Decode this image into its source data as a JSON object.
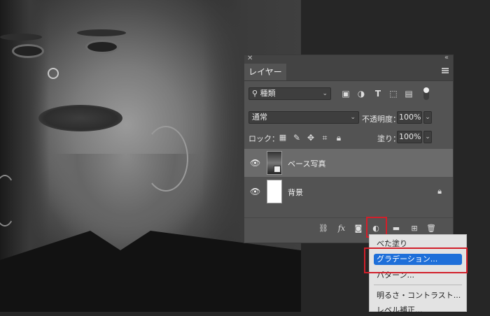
{
  "panel": {
    "tab_label": "レイヤー",
    "filter_kind": "種類",
    "blend_mode": "通常",
    "opacity_label": "不透明度：",
    "opacity_value": "100%",
    "lock_label": "ロック：",
    "fill_label": "塗り：",
    "fill_value": "100%",
    "layers": [
      {
        "name": "ベース写真",
        "selected": true,
        "visible": true,
        "locked": false
      },
      {
        "name": "背景",
        "selected": false,
        "visible": true,
        "locked": true
      }
    ],
    "footer_icons": [
      "link-icon",
      "fx-icon",
      "mask-icon",
      "adjustment-layer-icon",
      "folder-icon",
      "new-layer-icon",
      "trash-icon"
    ],
    "fx_label": "fx"
  },
  "menu": {
    "items": [
      {
        "label": "べた塗り",
        "active": false
      },
      {
        "label": "グラデーション...",
        "active": true
      },
      {
        "label": "パターン...",
        "active": false
      },
      {
        "label": "明るさ・コントラスト...",
        "active": false
      },
      {
        "label": "レベル補正...",
        "active": false
      }
    ]
  },
  "colors": {
    "highlight": "#d21f2a",
    "menu_active": "#1e6fd9",
    "panel_bg": "#535353"
  }
}
